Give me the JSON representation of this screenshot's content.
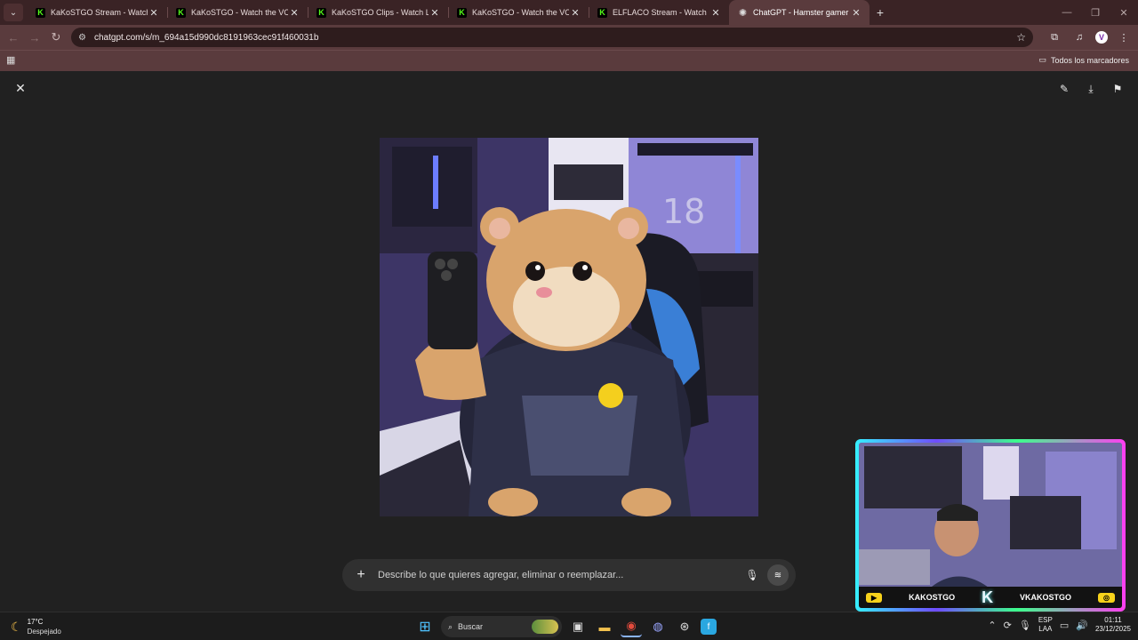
{
  "tabs": [
    {
      "title": "KaKoSTGO Stream - Watch Live",
      "favicon": "kick-icon",
      "active": false
    },
    {
      "title": "KaKoSTGO - Watch the VOD on",
      "favicon": "kick-icon",
      "active": false
    },
    {
      "title": "KaKoSTGO Clips - Watch Live o",
      "favicon": "kick-icon",
      "active": false
    },
    {
      "title": "KaKoSTGO - Watch the VOD on",
      "favicon": "kick-icon",
      "active": false
    },
    {
      "title": "ELFLACO Stream - Watch Live o",
      "favicon": "kick-icon",
      "active": false
    },
    {
      "title": "ChatGPT - Hamster gamer con",
      "favicon": "chatgpt-icon",
      "active": true
    }
  ],
  "address_bar": {
    "url": "chatgpt.com/s/m_694a15d990dc8191963cec91f460031b"
  },
  "bookmarks": {
    "all_label": "Todos los marcadores"
  },
  "prompt": {
    "placeholder": "Describe lo que quieres agregar, eliminar o reemplazar..."
  },
  "webcam": {
    "left_name": "KAKOSTGO",
    "right_name": "VKAKOSTGO"
  },
  "taskbar": {
    "weather_temp": "17°C",
    "weather_desc": "Despejado",
    "search_label": "Buscar",
    "lang_top": "ESP",
    "lang_bottom": "LAA",
    "time": "01:11",
    "date": "23/12/2025"
  },
  "colors": {
    "tabstrip": "#3a2325",
    "toolbar": "#5a3b3d",
    "page_bg": "#212121",
    "kick_green": "#53fc18"
  }
}
